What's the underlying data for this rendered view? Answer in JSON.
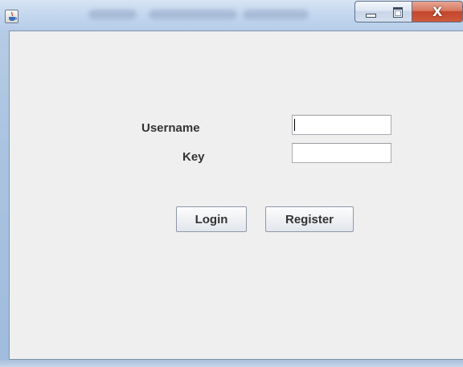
{
  "window": {
    "icon": "java-cup-icon",
    "controls": {
      "minimize": "minimize-icon",
      "maximize": "maximize-icon",
      "close_glyph": "X"
    }
  },
  "form": {
    "username_label": "Username",
    "key_label": "Key",
    "username_value": "",
    "key_value": "",
    "login_label": "Login",
    "register_label": "Register"
  },
  "colors": {
    "titlebar": "#c3d6ee",
    "client_background": "#efefef",
    "close_button": "#c3452b"
  }
}
